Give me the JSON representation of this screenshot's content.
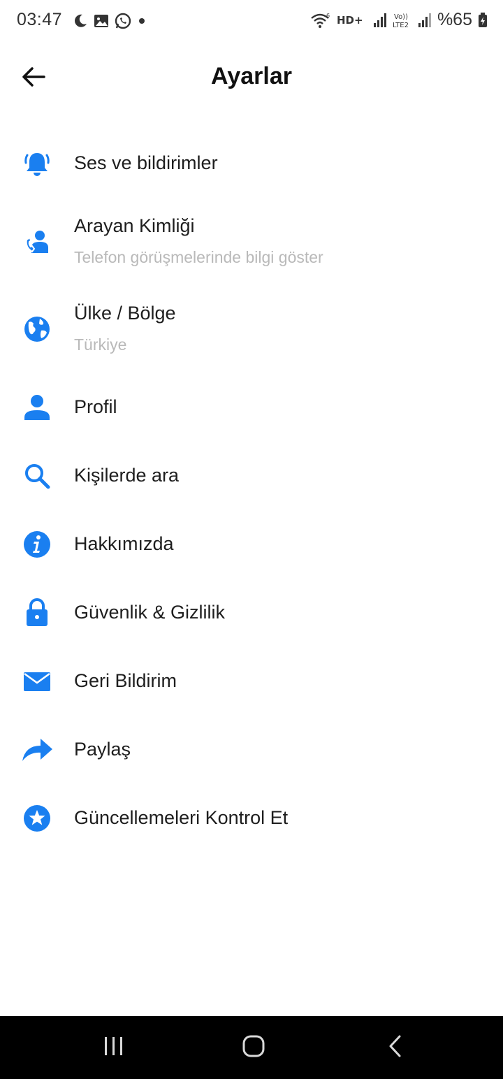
{
  "status_bar": {
    "time": "03:47",
    "left_icons": [
      "moon-icon",
      "gallery-icon",
      "whatsapp-icon",
      "dot-icon"
    ],
    "right_icons": [
      "wifi-icon",
      "hd-plus-icon",
      "signal-1-icon",
      "volte-lte2-icon",
      "signal-2-icon",
      "battery-icon"
    ],
    "hd_label": "HD+",
    "volte_label": "Vo)) LTE2",
    "battery": "%65"
  },
  "app_bar": {
    "title": "Ayarlar",
    "back_icon": "arrow-left-icon"
  },
  "accent_color": "#1a7ff0",
  "settings": [
    {
      "title": "Ses ve bildirimler",
      "subtitle": "",
      "icon": "bell-icon"
    },
    {
      "title": "Arayan Kimliği",
      "subtitle": "Telefon görüşmelerinde bilgi göster",
      "icon": "caller-id-icon"
    },
    {
      "title": "Ülke / Bölge",
      "subtitle": "Türkiye",
      "icon": "globe-icon"
    },
    {
      "title": "Profil",
      "subtitle": "",
      "icon": "person-icon"
    },
    {
      "title": "Kişilerde ara",
      "subtitle": "",
      "icon": "search-icon"
    },
    {
      "title": "Hakkımızda",
      "subtitle": "",
      "icon": "info-icon"
    },
    {
      "title": "Güvenlik & Gizlilik",
      "subtitle": "",
      "icon": "lock-icon"
    },
    {
      "title": "Geri Bildirim",
      "subtitle": "",
      "icon": "mail-icon"
    },
    {
      "title": "Paylaş",
      "subtitle": "",
      "icon": "share-icon"
    },
    {
      "title": "Güncellemeleri Kontrol Et",
      "subtitle": "",
      "icon": "star-badge-icon"
    }
  ],
  "nav_bar": {
    "buttons": [
      "recent-apps-icon",
      "home-icon",
      "back-nav-icon"
    ]
  }
}
